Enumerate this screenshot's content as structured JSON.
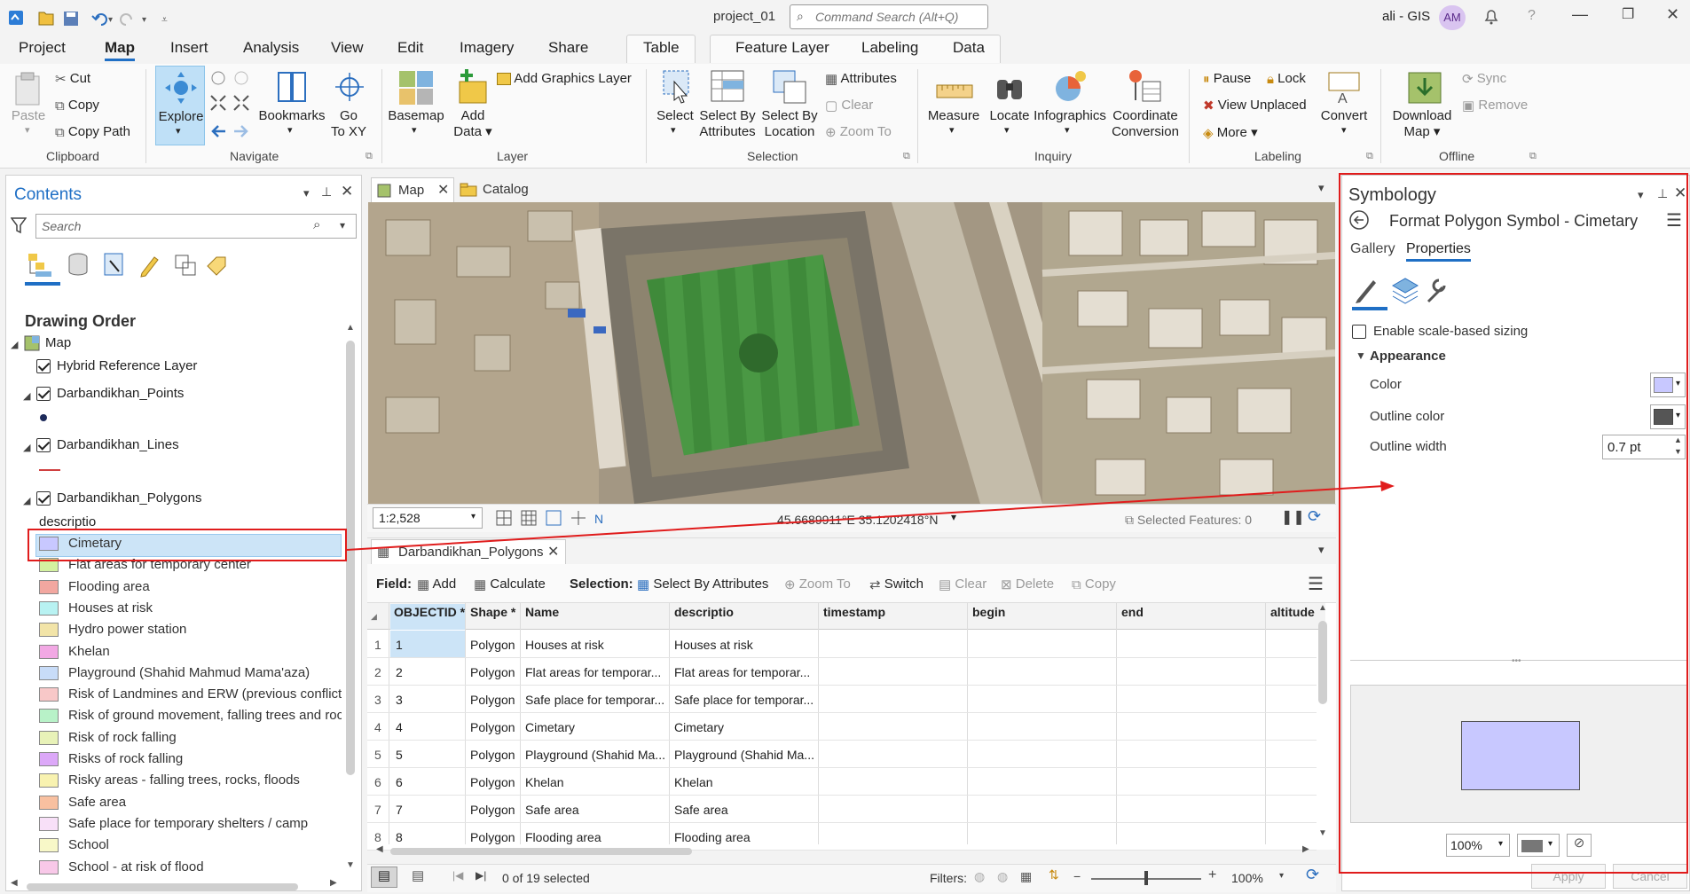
{
  "title": {
    "project": "project_01",
    "search_placeholder": "Command Search (Alt+Q)",
    "user": "ali - GIS",
    "avatar": "AM",
    "help": "?"
  },
  "tabs": [
    {
      "label": "Project"
    },
    {
      "label": "Map"
    },
    {
      "label": "Insert"
    },
    {
      "label": "Analysis"
    },
    {
      "label": "View"
    },
    {
      "label": "Edit"
    },
    {
      "label": "Imagery"
    },
    {
      "label": "Share"
    },
    {
      "label": "Table"
    },
    {
      "label": "Feature Layer"
    },
    {
      "label": "Labeling"
    },
    {
      "label": "Data"
    }
  ],
  "ribbon": {
    "paste": "Paste",
    "cut": "Cut",
    "copy": "Copy",
    "copy_path": "Copy Path",
    "clipboard": "Clipboard",
    "explore": "Explore",
    "bookmarks": "Bookmarks",
    "goto1": "Go",
    "goto2": "To XY",
    "navigate": "Navigate",
    "basemap": "Basemap",
    "add1": "Add",
    "add2": "Data",
    "add_graphics": "Add Graphics Layer",
    "layer": "Layer",
    "select": "Select",
    "sba1": "Select By",
    "sba2": "Attributes",
    "sbl1": "Select By",
    "sbl2": "Location",
    "attributes": "Attributes",
    "clear": "Clear",
    "zoom_to": "Zoom To",
    "selection": "Selection",
    "measure": "Measure",
    "locate": "Locate",
    "infographics": "Infographics",
    "coord1": "Coordinate",
    "coord2": "Conversion",
    "inquiry": "Inquiry",
    "pause": "Pause",
    "lock": "Lock",
    "view_unplaced": "View Unplaced",
    "more": "More",
    "convert": "Convert",
    "labeling": "Labeling",
    "dl1": "Download",
    "dl2": "Map",
    "sync": "Sync",
    "remove": "Remove",
    "offline": "Offline"
  },
  "contents": {
    "title": "Contents",
    "search_placeholder": "Search",
    "drawing_order": "Drawing Order",
    "layers": {
      "map": "Map",
      "hybrid": "Hybrid Reference Layer",
      "points": "Darbandikhan_Points",
      "lines": "Darbandikhan_Lines",
      "polygons": "Darbandikhan_Polygons",
      "field": "descriptio"
    },
    "legend": [
      {
        "label": "Cimetary",
        "color": "#c8c8ff"
      },
      {
        "label": "Flat areas for temporary center",
        "color": "#d4f2a0"
      },
      {
        "label": "Flooding area",
        "color": "#f2a7a0"
      },
      {
        "label": "Houses at risk",
        "color": "#b8f2f2"
      },
      {
        "label": "Hydro power station",
        "color": "#f2e4a8"
      },
      {
        "label": "Khelan",
        "color": "#f2a8e4"
      },
      {
        "label": "Playground (Shahid Mahmud Mama'aza)",
        "color": "#c8dcf8"
      },
      {
        "label": "Risk of Landmines and ERW (previous conflict l",
        "color": "#f8c8c8"
      },
      {
        "label": "Risk of ground movement, falling trees and roc",
        "color": "#b8f2c8"
      },
      {
        "label": "Risk of rock falling",
        "color": "#e8f2b8"
      },
      {
        "label": "Risks of rock falling",
        "color": "#dca8f8"
      },
      {
        "label": "Risky areas - falling trees, rocks, floods",
        "color": "#f8f2b0"
      },
      {
        "label": "Safe area",
        "color": "#f8c0a0"
      },
      {
        "label": "Safe place for temporary shelters / camp",
        "color": "#f8e0f8"
      },
      {
        "label": "School",
        "color": "#f8f8c8"
      },
      {
        "label": "School - at risk of flood",
        "color": "#f8c8e8"
      }
    ]
  },
  "map": {
    "tab_map": "Map",
    "tab_catalog": "Catalog",
    "scale": "1:2,528",
    "coords": "45.6689911°E 35.1202418°N",
    "selected_features": "Selected Features: 0"
  },
  "table": {
    "tab": "Darbandikhan_Polygons",
    "field": "Field:",
    "add": "Add",
    "calculate": "Calculate",
    "selection": "Selection:",
    "sba": "Select By Attributes",
    "zoom_to": "Zoom To",
    "switch": "Switch",
    "clear": "Clear",
    "delete": "Delete",
    "copy": "Copy",
    "headers": [
      "OBJECTID *",
      "Shape *",
      "Name",
      "descriptio",
      "timestamp",
      "begin",
      "end",
      "altitude"
    ],
    "rows": [
      {
        "n": "1",
        "id": "1",
        "shape": "Polygon",
        "name": "Houses at risk",
        "desc": "Houses at risk"
      },
      {
        "n": "2",
        "id": "2",
        "shape": "Polygon",
        "name": "Flat areas for temporar...",
        "desc": "Flat areas for temporar..."
      },
      {
        "n": "3",
        "id": "3",
        "shape": "Polygon",
        "name": "Safe place for temporar...",
        "desc": "Safe place for temporar..."
      },
      {
        "n": "4",
        "id": "4",
        "shape": "Polygon",
        "name": "Cimetary",
        "desc": "Cimetary"
      },
      {
        "n": "5",
        "id": "5",
        "shape": "Polygon",
        "name": "Playground (Shahid Ma...",
        "desc": "Playground (Shahid Ma..."
      },
      {
        "n": "6",
        "id": "6",
        "shape": "Polygon",
        "name": "Khelan",
        "desc": "Khelan"
      },
      {
        "n": "7",
        "id": "7",
        "shape": "Polygon",
        "name": "Safe area",
        "desc": "Safe area"
      },
      {
        "n": "8",
        "id": "8",
        "shape": "Polygon",
        "name": "Flooding area",
        "desc": "Flooding area"
      }
    ],
    "status": "0 of 19 selected",
    "filters": "Filters:",
    "zoom": "100%"
  },
  "symbology": {
    "title": "Symbology",
    "subtitle": "Format Polygon Symbol - Cimetary",
    "gallery": "Gallery",
    "properties": "Properties",
    "scale_sizing": "Enable scale-based sizing",
    "appearance": "Appearance",
    "color": "Color",
    "outline_color": "Outline color",
    "outline_width": "Outline width",
    "outline_width_value": "0.7 pt",
    "preview_zoom": "100%",
    "apply": "Apply",
    "cancel": "Cancel",
    "fill_color": "#c8c8ff",
    "outline_hex": "#555555"
  }
}
